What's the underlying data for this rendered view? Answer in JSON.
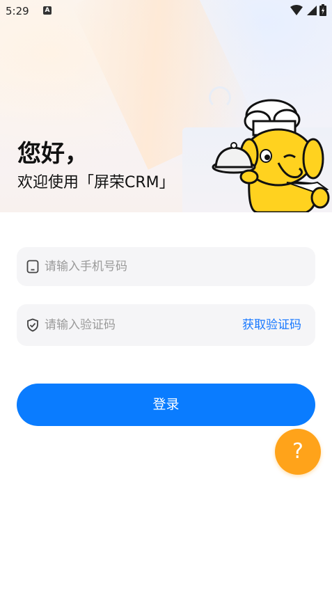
{
  "status_bar": {
    "time": "5:29",
    "notification_icon": "A",
    "icons": [
      "wifi-icon",
      "signal-icon",
      "battery-charging-icon"
    ]
  },
  "greeting": {
    "title": "您好，",
    "subtitle": "欢迎使用「屏荣CRM」"
  },
  "form": {
    "phone": {
      "placeholder": "请输入手机号码",
      "value": "",
      "icon": "phone-icon"
    },
    "code": {
      "placeholder": "请输入验证码",
      "value": "",
      "icon": "shield-check-icon",
      "get_code_label": "获取验证码"
    },
    "login_label": "登录"
  },
  "help": {
    "label": "?"
  },
  "colors": {
    "primary": "#0a7cff",
    "link": "#1677ff",
    "help": "#ffa31a",
    "mascot": "#ffd21f"
  }
}
